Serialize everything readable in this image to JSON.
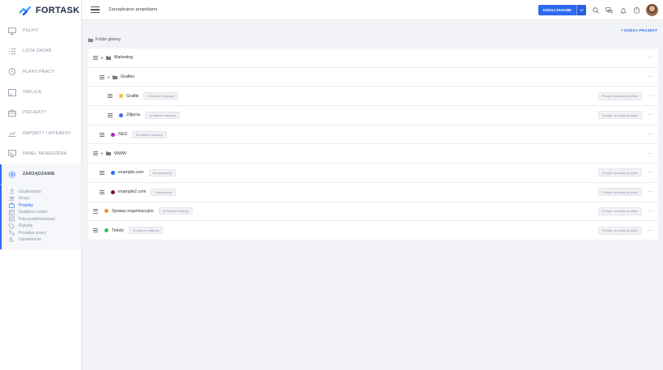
{
  "app": {
    "name": "FORTASK"
  },
  "sidebar": {
    "items": [
      {
        "label": "PULPIT",
        "icon": "monitor-icon"
      },
      {
        "label": "LISTA ZADAŃ",
        "icon": "task-list-icon"
      },
      {
        "label": "PLANY PRACY",
        "icon": "clock-icon"
      },
      {
        "label": "TABLICA",
        "icon": "board-icon"
      },
      {
        "label": "PROJEKTY",
        "icon": "briefcase-icon"
      },
      {
        "label": "RAPORTY I WYKRESY",
        "icon": "chart-icon"
      },
      {
        "label": "PANEL MENEDŻERA",
        "icon": "manager-panel-icon"
      }
    ],
    "active": {
      "label": "ZARZĄDZANIE",
      "icon": "settings-icon"
    },
    "sub_items": [
      {
        "label": "Użytkownicy",
        "icon": "user-icon"
      },
      {
        "label": "Grupy",
        "icon": "group-icon"
      },
      {
        "label": "Projekty",
        "icon": "briefcase-icon"
      },
      {
        "label": "Szablony zadań",
        "icon": "template-icon"
      },
      {
        "label": "Pola predefiniowane",
        "icon": "fields-icon"
      },
      {
        "label": "Etykiety",
        "icon": "tag-icon"
      },
      {
        "label": "Przepływ pracy",
        "icon": "workflow-icon"
      },
      {
        "label": "Uprawnienia",
        "icon": "permissions-icon"
      }
    ]
  },
  "header": {
    "title": "Zarządzanie projektami",
    "add_task": "DODAJ ZADANIE"
  },
  "main": {
    "add_project": "+ DODAJ PROJEKT",
    "root_folder": "Folder główny",
    "goto_label": "Przejdź na widok projektu",
    "rows": [
      {
        "name": "Marketing",
        "type": "folder"
      },
      {
        "name": "Grafiko",
        "type": "folder"
      },
      {
        "name": "Grafiki",
        "type": "project",
        "color": "#f2c230",
        "status": "W trakcie realizacji"
      },
      {
        "name": "Zdjęcia",
        "type": "project",
        "color": "#3b6be8",
        "status": "W trakcie realizacji"
      },
      {
        "name": "SEO",
        "type": "project",
        "color": "#b523c9",
        "status": "W trakcie realizacji"
      },
      {
        "name": "WWW",
        "type": "folder"
      },
      {
        "name": "example.com",
        "type": "project",
        "color": "#2e6af0",
        "status": "Utrzymywany"
      },
      {
        "name": "example2.com",
        "type": "project",
        "color": "#6b1a22",
        "status": "Zakończony"
      },
      {
        "name": "Sprawy organizacyjne",
        "type": "project",
        "color": "#f0902e",
        "status": "W trakcie realizacji"
      },
      {
        "name": "Teksty",
        "type": "project",
        "color": "#3cc25a",
        "status": "W trakcie realizacji"
      }
    ]
  }
}
